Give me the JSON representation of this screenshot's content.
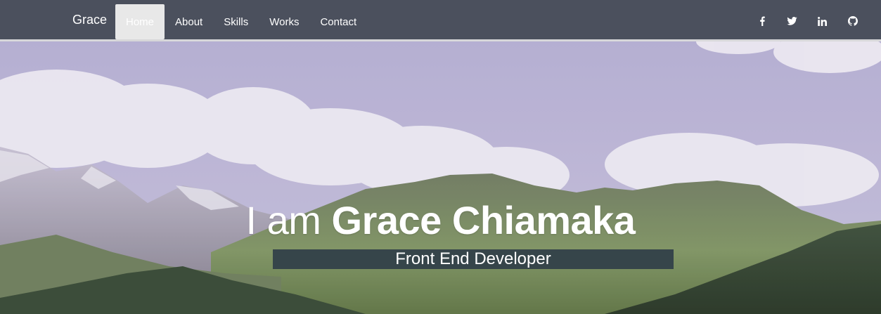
{
  "navbar": {
    "brand": "Grace",
    "items": [
      {
        "label": "Home",
        "active": true
      },
      {
        "label": "About",
        "active": false
      },
      {
        "label": "Skills",
        "active": false
      },
      {
        "label": "Works",
        "active": false
      },
      {
        "label": "Contact",
        "active": false
      }
    ],
    "social": [
      "facebook-icon",
      "twitter-icon",
      "linkedin-icon",
      "github-icon"
    ]
  },
  "hero": {
    "intro": "I am",
    "name": "Grace Chiamaka",
    "role": "Front End Developer"
  },
  "colors": {
    "navbar_bg": "#4b505d",
    "active_tab_bg": "#e8e8e8",
    "role_bar_bg": "#36454a",
    "sky": "#bcb6d6"
  }
}
